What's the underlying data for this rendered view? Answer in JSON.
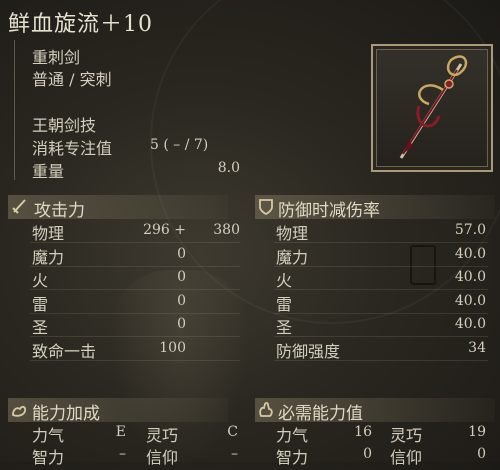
{
  "weapon": {
    "name": "鲜血旋流＋10",
    "type": "重刺剑",
    "attack_type": "普通 / 突刺",
    "skill": "王朝剑技",
    "fp_cost_label": "消耗专注值",
    "fp_cost_value": "5 (  –  /   7)",
    "weight_label": "重量",
    "weight_value": "8.0"
  },
  "attack": {
    "heading": "攻击力",
    "rows": [
      {
        "label": "物理",
        "value": "296 +",
        "extra": "380"
      },
      {
        "label": "魔力",
        "value": "0",
        "extra": ""
      },
      {
        "label": "火",
        "value": "0",
        "extra": ""
      },
      {
        "label": "雷",
        "value": "0",
        "extra": ""
      },
      {
        "label": "圣",
        "value": "0",
        "extra": ""
      },
      {
        "label": "致命一击",
        "value": "100",
        "extra": ""
      }
    ]
  },
  "defense": {
    "heading": "防御时减伤率",
    "rows": [
      {
        "label": "物理",
        "value": "57.0"
      },
      {
        "label": "魔力",
        "value": "40.0"
      },
      {
        "label": "火",
        "value": "40.0"
      },
      {
        "label": "雷",
        "value": "40.0"
      },
      {
        "label": "圣",
        "value": "40.0"
      },
      {
        "label": "防御强度",
        "value": "34"
      }
    ]
  },
  "scaling": {
    "heading": "能力加成",
    "rows": [
      {
        "a_label": "力气",
        "a_value": "E",
        "b_label": "灵巧",
        "b_value": "C"
      },
      {
        "a_label": "智力",
        "a_value": "–",
        "b_label": "信仰",
        "b_value": "–"
      }
    ]
  },
  "requirements": {
    "heading": "必需能力值",
    "rows": [
      {
        "a_label": "力气",
        "a_value": "16",
        "b_label": "灵巧",
        "b_value": "19"
      },
      {
        "a_label": "智力",
        "a_value": "0",
        "b_label": "信仰",
        "b_value": "0"
      }
    ]
  },
  "colors": {
    "accent": "#a89a7a",
    "text": "#d4cebd",
    "blade": "#8a1c2a"
  }
}
